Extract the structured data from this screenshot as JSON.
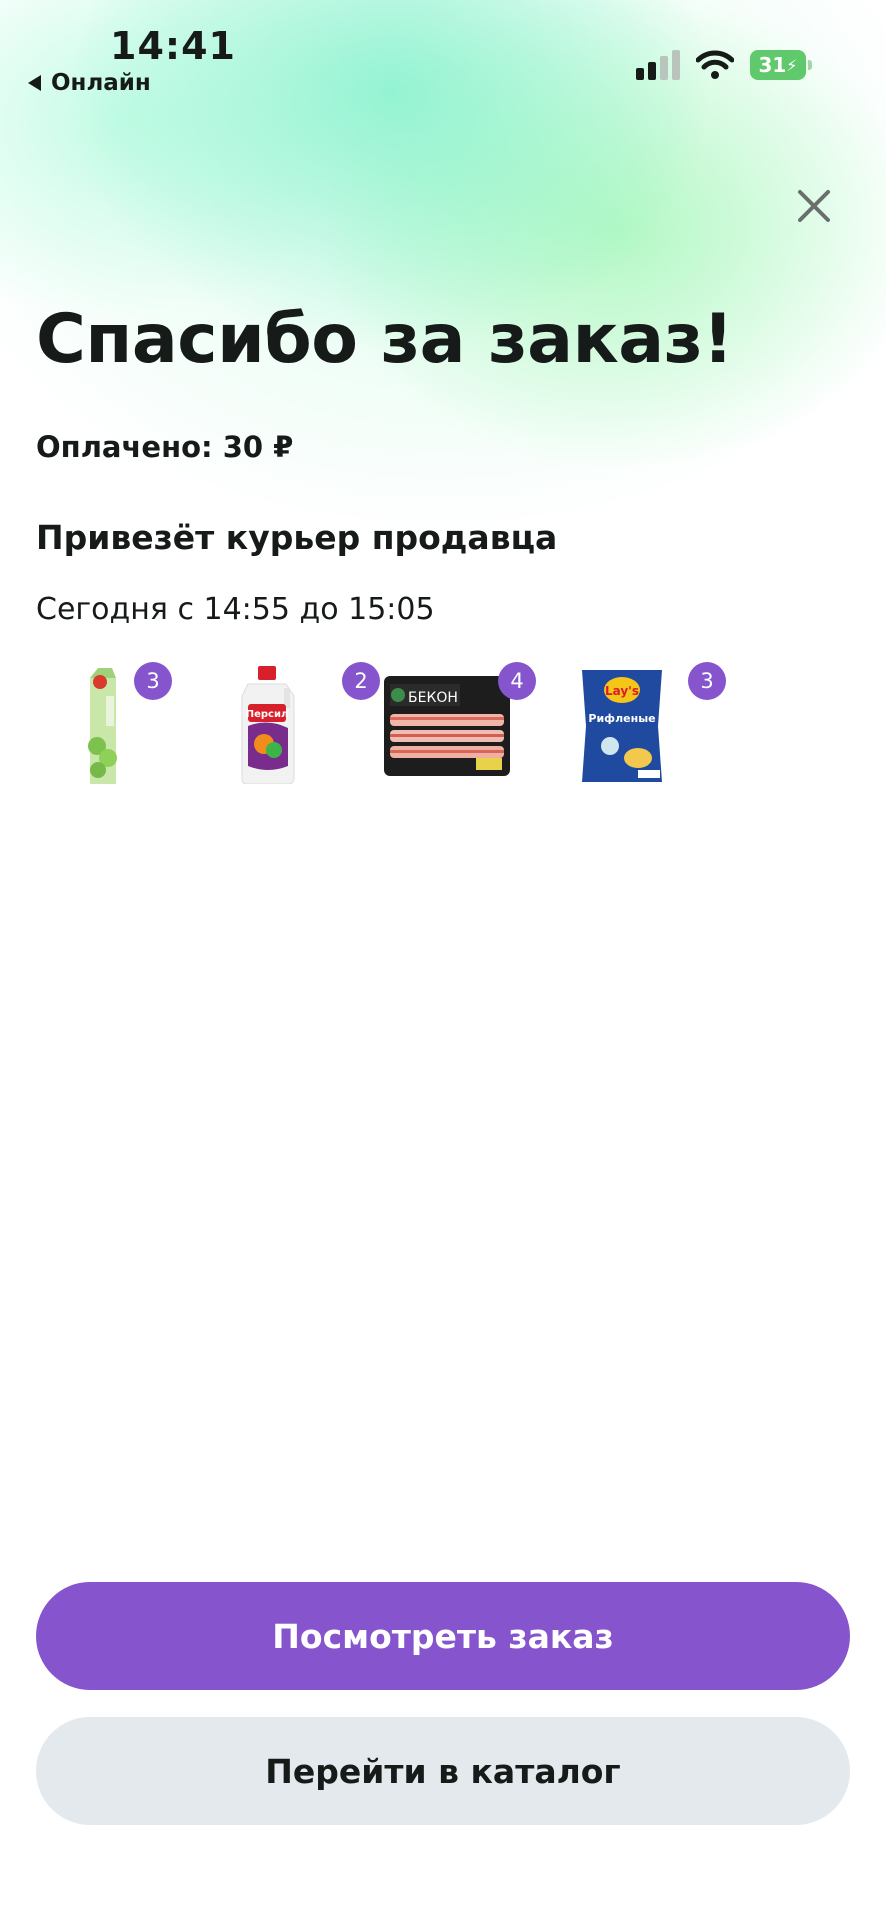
{
  "status_bar": {
    "time": "14:41",
    "back_app": "Онлайн",
    "battery": "31"
  },
  "header": {
    "title": "Спасибо за заказ!"
  },
  "order": {
    "paid": "Оплачено: 30 ₽",
    "delivery_method": "Привезёт курьер продавца",
    "delivery_time": "Сегодня с 14:55 до 15:05",
    "items": [
      {
        "icon": "juice-carton-icon",
        "quantity": "3"
      },
      {
        "icon": "detergent-bottle-icon",
        "quantity": "2",
        "brand": "Персил"
      },
      {
        "icon": "bacon-pack-icon",
        "quantity": "4",
        "label": "БЕКОН"
      },
      {
        "icon": "chips-bag-icon",
        "quantity": "3",
        "brand": "Lay's",
        "label": "Рифленые"
      }
    ]
  },
  "actions": {
    "view_order": "Посмотреть заказ",
    "go_catalog": "Перейти в каталог"
  },
  "colors": {
    "accent": "#8654cc",
    "secondary_button": "#e4e9ee",
    "text": "#161a18"
  }
}
